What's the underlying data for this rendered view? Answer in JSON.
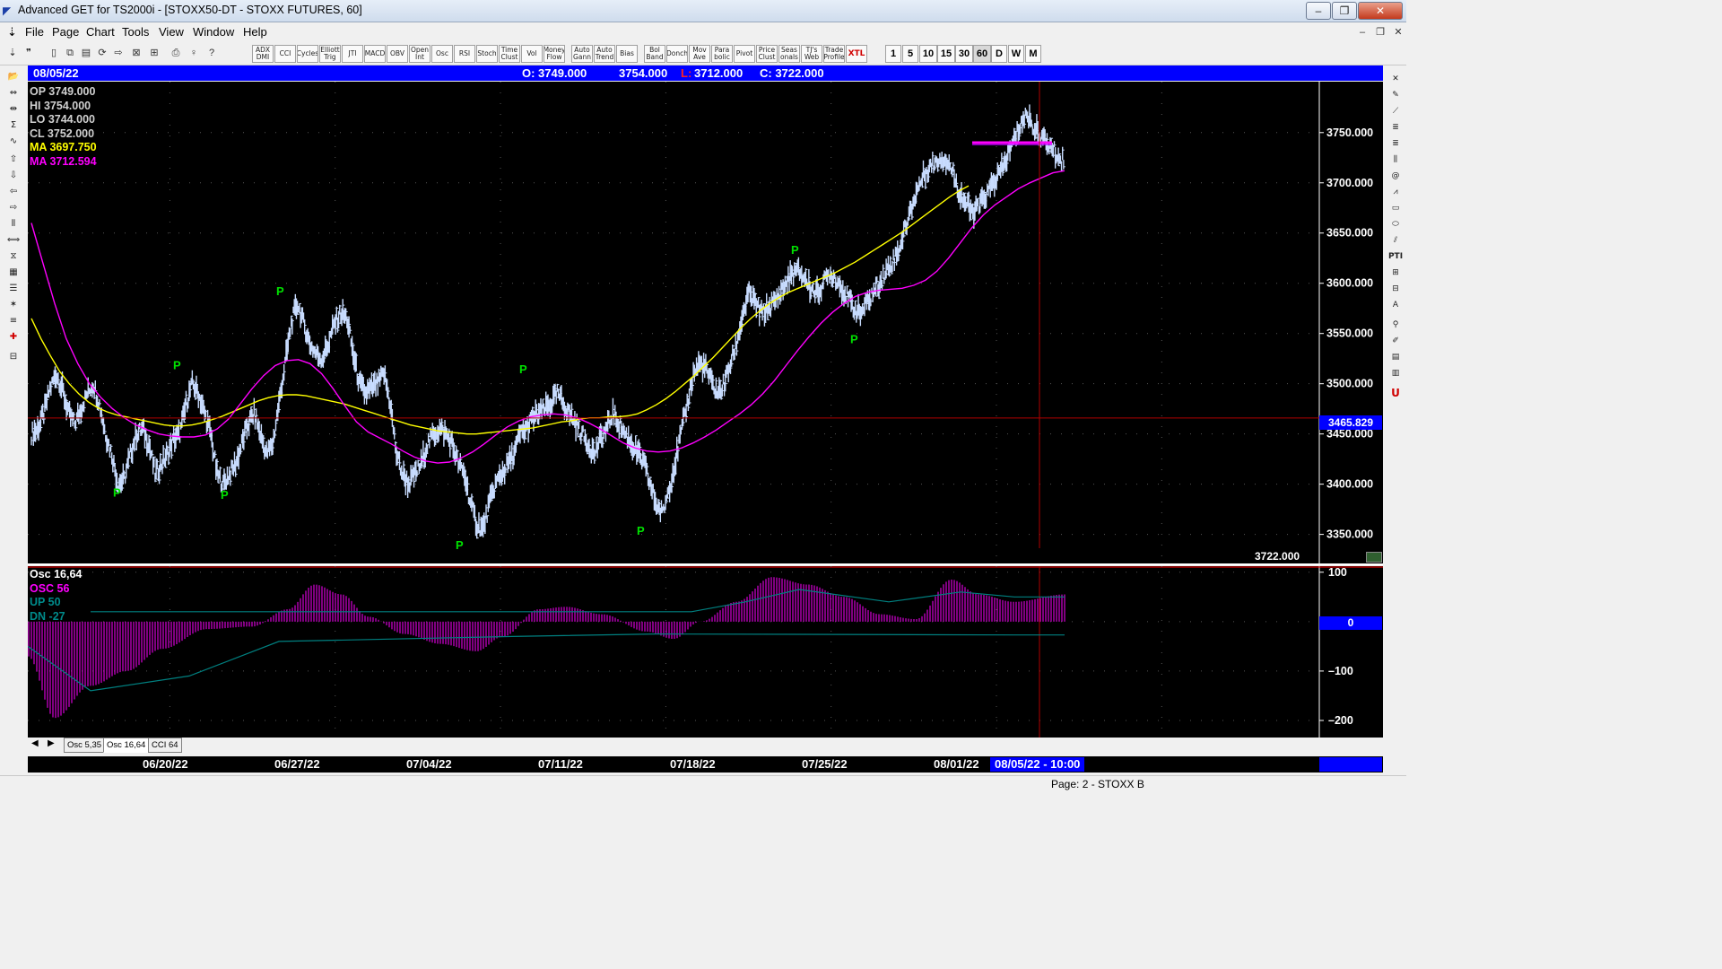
{
  "window": {
    "title": "Advanced GET for TS2000i - [STOXX50-DT - STOXX FUTURES, 60]",
    "minimize": "–",
    "maximize": "❐",
    "close": "✕"
  },
  "menu": {
    "items": [
      "File",
      "Page",
      "Chart",
      "Tools",
      "View",
      "Window",
      "Help"
    ]
  },
  "toolbar": {
    "studies": [
      "ADX DMI",
      "CCI",
      "Cycles",
      "Elliott Trig",
      "JTI",
      "MACD",
      "OBV",
      "Open Int",
      "Osc",
      "RSI",
      "Stoch",
      "Time Clust",
      "Vol",
      "Money Flow",
      "Auto Gann",
      "Auto Trend",
      "Bias",
      "Bol Band",
      "Donch",
      "Mov Ave",
      "Para bolic",
      "Pivot",
      "Price Clust",
      "Seas onals",
      "TJ's Web",
      "Trade Profile",
      "XTL"
    ],
    "periods": [
      "1",
      "5",
      "10",
      "15",
      "30",
      "60",
      "D",
      "W",
      "M"
    ]
  },
  "infobar": {
    "date": "08/05/22",
    "open": "O: 3749.000",
    "high": "3754.000",
    "low_label": "L:",
    "low": "3712.000",
    "close": "C: 3722.000"
  },
  "readout": {
    "op": "OP  3749.000",
    "hi": "HI   3754.000",
    "lo": "LO   3744.000",
    "cl": "CL   3752.000",
    "ma1": "MA  3697.750",
    "ma2": "MA  3712.594"
  },
  "main_axis": {
    "labels": [
      "3750.000",
      "3700.000",
      "3650.000",
      "3600.000",
      "3550.000",
      "3500.000",
      "3450.000",
      "3400.000",
      "3350.000"
    ],
    "cursor_price": "3465.829",
    "last_close": "3722.000"
  },
  "osc_readout": {
    "title": "Osc 16,64",
    "osc": "OSC 56",
    "up": "UP   50",
    "dn": "DN   -27"
  },
  "osc_axis": {
    "labels": [
      "100",
      "0",
      "-100",
      "-200"
    ],
    "zero_label": "0"
  },
  "tabs": [
    "Osc 5,35",
    "Osc 16,64",
    "CCI 64"
  ],
  "dates": [
    "06/20/22",
    "06/27/22",
    "07/04/22",
    "07/11/22",
    "07/18/22",
    "07/25/22",
    "08/01/22"
  ],
  "cursor_date": "08/05/22 - 10:00",
  "status": "Page: 2 - STOXX B",
  "pivot_label": "P",
  "colors": {
    "background": "#000000",
    "bar": "#c8dcff",
    "ma_slow": "#ffff00",
    "ma_fast": "#ff00ff",
    "osc": "#ff00ff",
    "bands": "#008080",
    "pivot": "#00e000",
    "cursor": "#b00000",
    "infobar": "#0000ff"
  },
  "chart_data": {
    "type": "line",
    "title": "STOXX50-DT - STOXX FUTURES, 60",
    "price_range": [
      3330,
      3790
    ],
    "osc_range": [
      -220,
      105
    ],
    "closes": [
      3450,
      3455,
      3470,
      3495,
      3510,
      3495,
      3470,
      3460,
      3475,
      3490,
      3500,
      3480,
      3450,
      3430,
      3400,
      3405,
      3430,
      3450,
      3455,
      3440,
      3410,
      3420,
      3430,
      3445,
      3450,
      3480,
      3500,
      3490,
      3470,
      3450,
      3410,
      3400,
      3410,
      3420,
      3440,
      3460,
      3470,
      3450,
      3430,
      3440,
      3480,
      3520,
      3560,
      3580,
      3560,
      3540,
      3530,
      3525,
      3540,
      3560,
      3570,
      3565,
      3530,
      3500,
      3490,
      3495,
      3500,
      3510,
      3480,
      3430,
      3410,
      3400,
      3410,
      3420,
      3440,
      3450,
      3455,
      3450,
      3440,
      3420,
      3410,
      3380,
      3360,
      3355,
      3380,
      3400,
      3410,
      3420,
      3430,
      3450,
      3455,
      3465,
      3470,
      3475,
      3480,
      3490,
      3480,
      3470,
      3460,
      3450,
      3440,
      3430,
      3445,
      3455,
      3470,
      3460,
      3450,
      3440,
      3430,
      3420,
      3400,
      3380,
      3370,
      3395,
      3420,
      3450,
      3480,
      3510,
      3520,
      3515,
      3500,
      3490,
      3500,
      3520,
      3540,
      3570,
      3590,
      3580,
      3570,
      3575,
      3580,
      3590,
      3600,
      3610,
      3612,
      3605,
      3595,
      3590,
      3600,
      3610,
      3605,
      3595,
      3585,
      3575,
      3570,
      3580,
      3590,
      3600,
      3610,
      3620,
      3630,
      3650,
      3670,
      3690,
      3705,
      3715,
      3720,
      3725,
      3722,
      3710,
      3690,
      3680,
      3670,
      3675,
      3685,
      3695,
      3705,
      3715,
      3730,
      3745,
      3760,
      3768,
      3755,
      3748,
      3740,
      3735,
      3725,
      3722
    ],
    "ma_slow": [
      3565,
      3545,
      3528,
      3512,
      3500,
      3490,
      3482,
      3476,
      3472,
      3469,
      3467,
      3465,
      3463,
      3461,
      3459,
      3458,
      3458,
      3459,
      3461,
      3464,
      3467,
      3471,
      3475,
      3479,
      3483,
      3486,
      3488,
      3489,
      3489,
      3488,
      3486,
      3484,
      3482,
      3480,
      3477,
      3474,
      3471,
      3468,
      3465,
      3462,
      3459,
      3457,
      3455,
      3453,
      3452,
      3451,
      3450,
      3450,
      3451,
      3452,
      3453,
      3454,
      3455,
      3456,
      3458,
      3460,
      3462,
      3463,
      3465,
      3466,
      3466,
      3467,
      3467,
      3468,
      3470,
      3474,
      3479,
      3485,
      3492,
      3500,
      3508,
      3517,
      3526,
      3536,
      3546,
      3556,
      3565,
      3573,
      3580,
      3586,
      3591,
      3595,
      3599,
      3603,
      3607,
      3611,
      3616,
      3621,
      3627,
      3633,
      3639,
      3645,
      3651,
      3658,
      3665,
      3672,
      3679,
      3686,
      3692,
      3697
    ],
    "ma_fast": [
      3660,
      3620,
      3580,
      3545,
      3520,
      3500,
      3486,
      3475,
      3466,
      3459,
      3454,
      3450,
      3448,
      3447,
      3447,
      3449,
      3455,
      3465,
      3480,
      3495,
      3508,
      3518,
      3523,
      3524,
      3520,
      3510,
      3495,
      3478,
      3462,
      3452,
      3446,
      3440,
      3433,
      3427,
      3423,
      3421,
      3422,
      3426,
      3432,
      3440,
      3449,
      3457,
      3463,
      3467,
      3469,
      3470,
      3469,
      3466,
      3461,
      3455,
      3448,
      3441,
      3436,
      3433,
      3432,
      3433,
      3436,
      3441,
      3447,
      3454,
      3462,
      3470,
      3479,
      3490,
      3503,
      3518,
      3533,
      3547,
      3560,
      3571,
      3580,
      3587,
      3591,
      3593,
      3594,
      3595,
      3598,
      3603,
      3612,
      3625,
      3640,
      3655,
      3668,
      3678,
      3686,
      3694,
      3700,
      3705,
      3710,
      3712
    ]
  }
}
